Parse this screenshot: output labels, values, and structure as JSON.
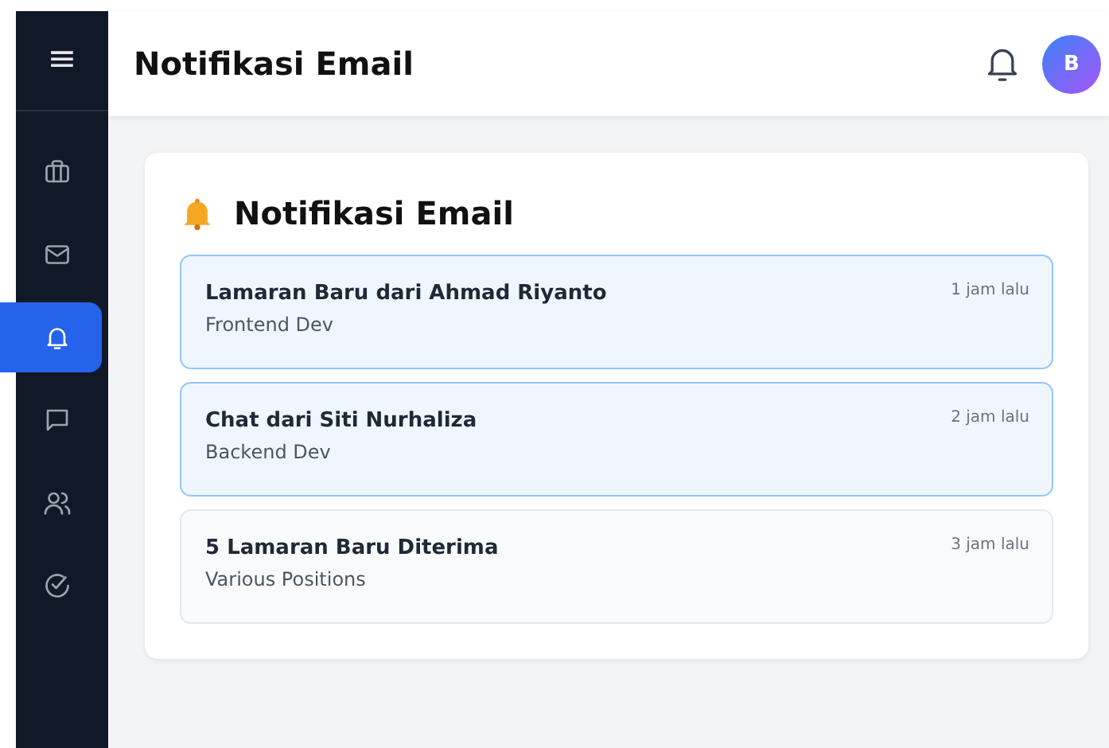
{
  "sidebar": {
    "menu_icon": "≡",
    "items": [
      {
        "kind": "briefcase",
        "selected": false
      },
      {
        "kind": "mail",
        "selected": false
      },
      {
        "kind": "bell",
        "selected": true
      },
      {
        "kind": "chat",
        "selected": false
      },
      {
        "kind": "users",
        "selected": false
      },
      {
        "kind": "check",
        "selected": false
      }
    ]
  },
  "header": {
    "title": "Notifikasi Email",
    "avatar": "B"
  },
  "card": {
    "title": "Notifikasi Email",
    "notifications": [
      {
        "title": "Lamaran Baru dari Ahmad Riyanto",
        "subtitle": "Frontend Dev",
        "time": "1 jam lalu",
        "unread": true
      },
      {
        "title": "Chat dari Siti Nurhaliza",
        "subtitle": "Backend Dev",
        "time": "2 jam lalu",
        "unread": true
      },
      {
        "title": "5 Lamaran Baru Diterima",
        "subtitle": "Various Positions",
        "time": "3 jam lalu",
        "unread": false
      }
    ]
  }
}
